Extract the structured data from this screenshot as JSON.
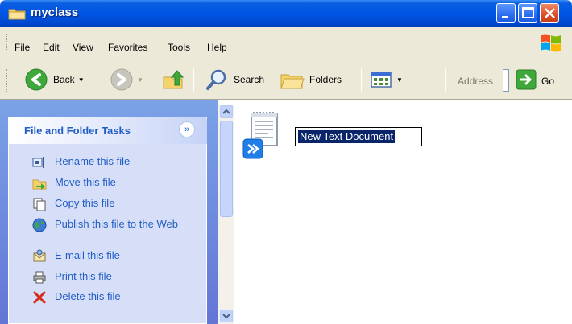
{
  "window": {
    "title": "myclass"
  },
  "menu": [
    "File",
    "Edit",
    "View",
    "Favorites",
    "Tools",
    "Help"
  ],
  "toolbar": {
    "back": "Back",
    "search": "Search",
    "folders": "Folders",
    "address": "Address",
    "go": "Go"
  },
  "tasks": {
    "title": "File and Folder Tasks",
    "collapse_glyph": "»",
    "items": [
      {
        "label": "Rename this file",
        "icon": "rename-icon"
      },
      {
        "label": "Move this file",
        "icon": "move-icon"
      },
      {
        "label": "Copy this file",
        "icon": "copy-icon"
      },
      {
        "label": "Publish this file to the Web",
        "icon": "publish-web-icon"
      },
      {
        "label": "E-mail this file",
        "icon": "email-icon"
      },
      {
        "label": "Print this file",
        "icon": "print-icon"
      },
      {
        "label": "Delete this file",
        "icon": "delete-icon"
      }
    ]
  },
  "content": {
    "file_name": "New Text Document"
  },
  "colors": {
    "titlebar": "#0055e5",
    "task_link": "#215dc6",
    "selection": "#0a246a"
  }
}
